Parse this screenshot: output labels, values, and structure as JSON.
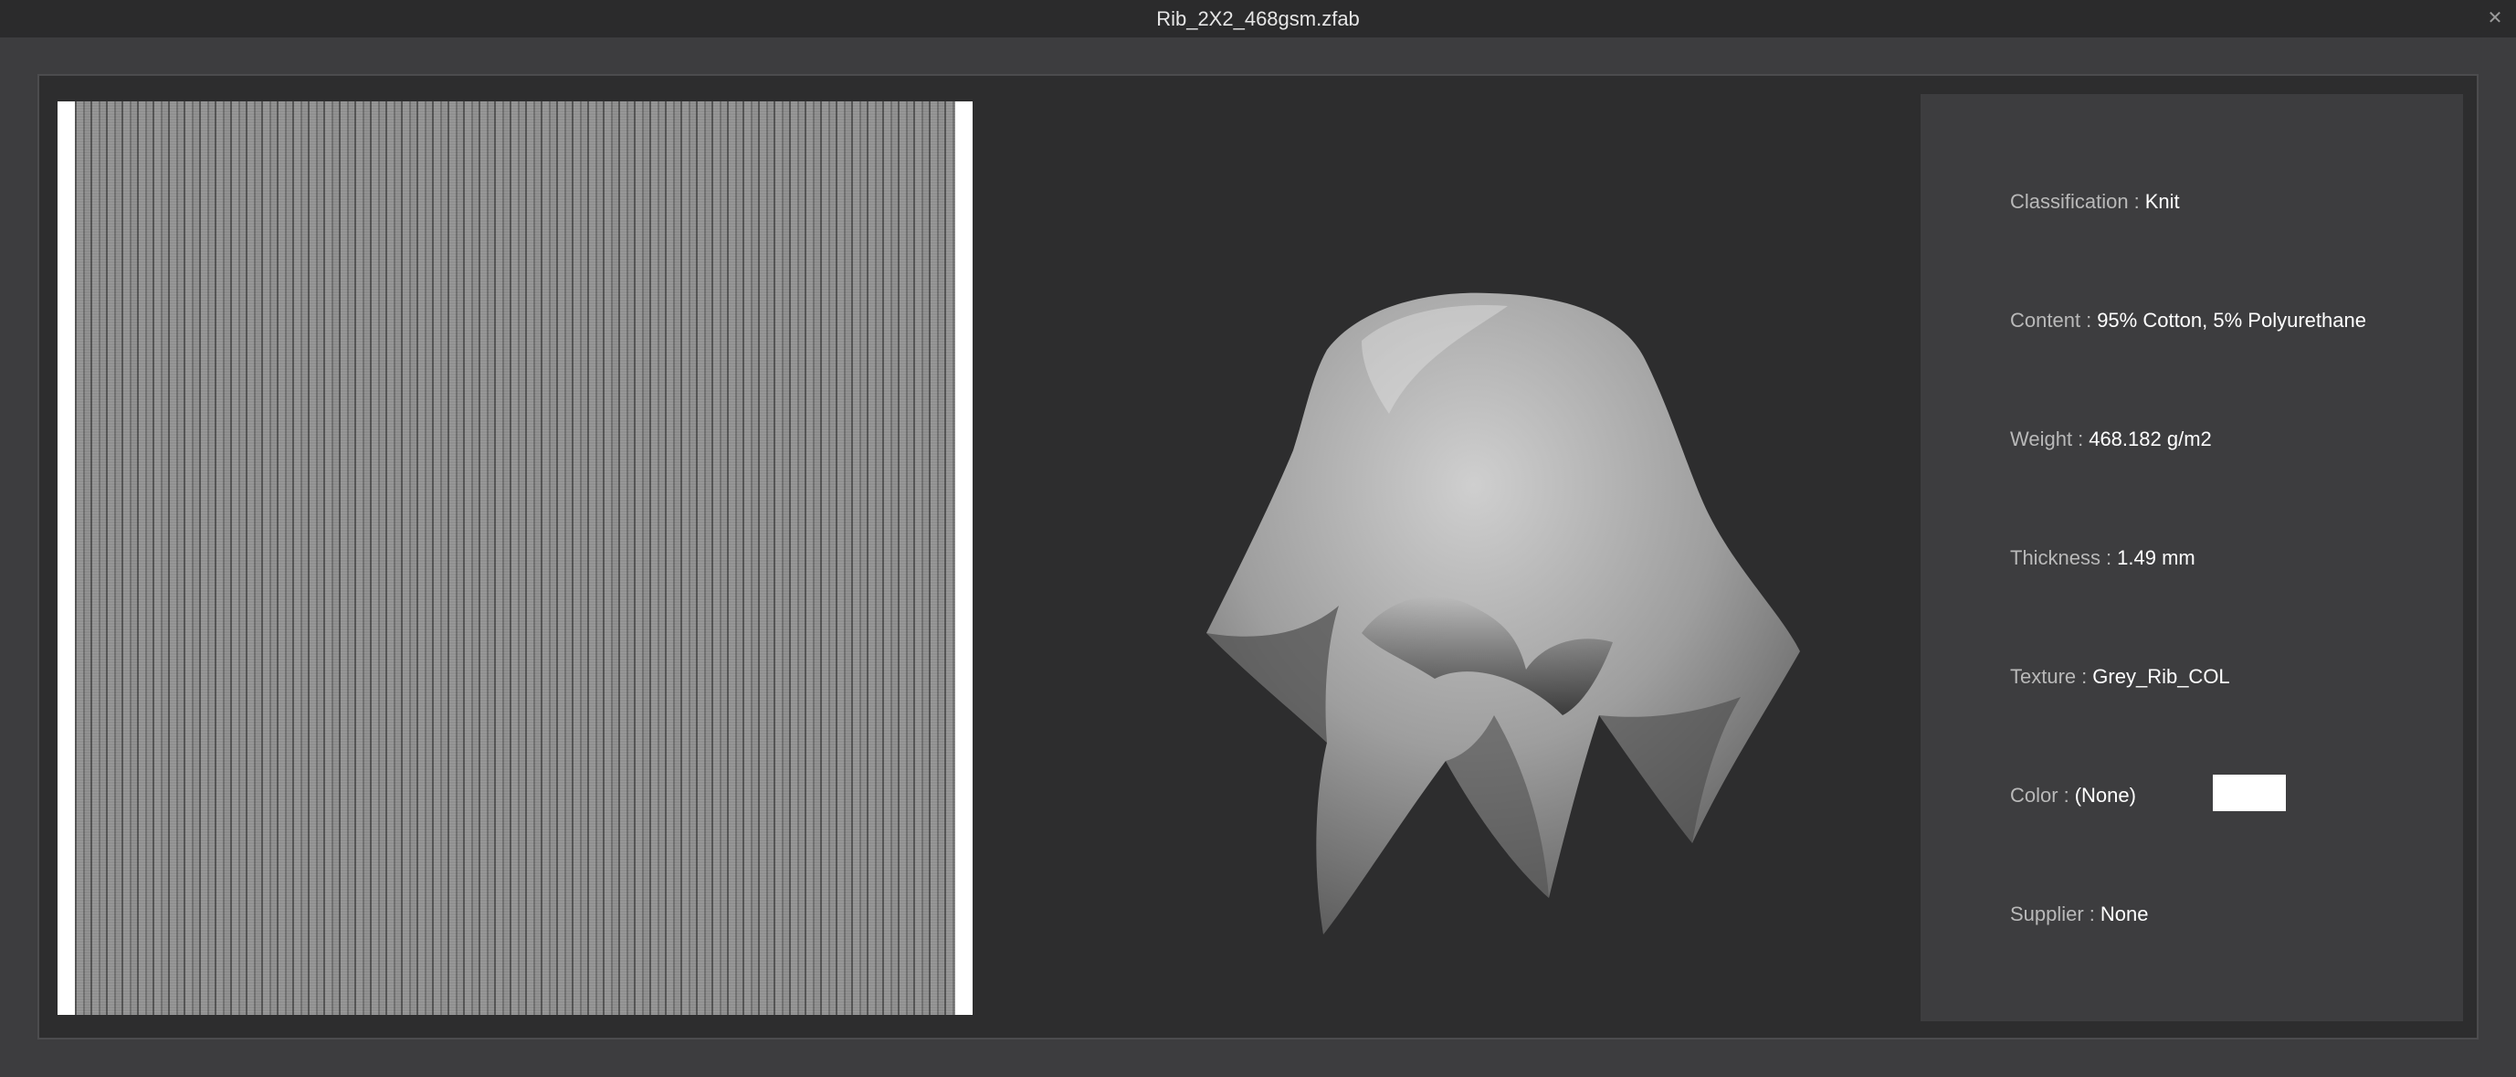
{
  "window": {
    "title": "Rib_2X2_468gsm.zfab",
    "close_glyph": "✕"
  },
  "info": {
    "classification": {
      "label": "Classification",
      "value": "Knit"
    },
    "content": {
      "label": "Content",
      "value": "95% Cotton, 5% Polyurethane"
    },
    "weight": {
      "label": "Weight",
      "value": "468.182 g/m2"
    },
    "thickness": {
      "label": "Thickness",
      "value": "1.49 mm"
    },
    "texture": {
      "label": "Texture",
      "value": "Grey_Rib_COL"
    },
    "color": {
      "label": "Color",
      "value": "(None)",
      "swatch": "#ffffff"
    },
    "supplier": {
      "label": "Supplier",
      "value": "None"
    }
  },
  "separator": ":"
}
